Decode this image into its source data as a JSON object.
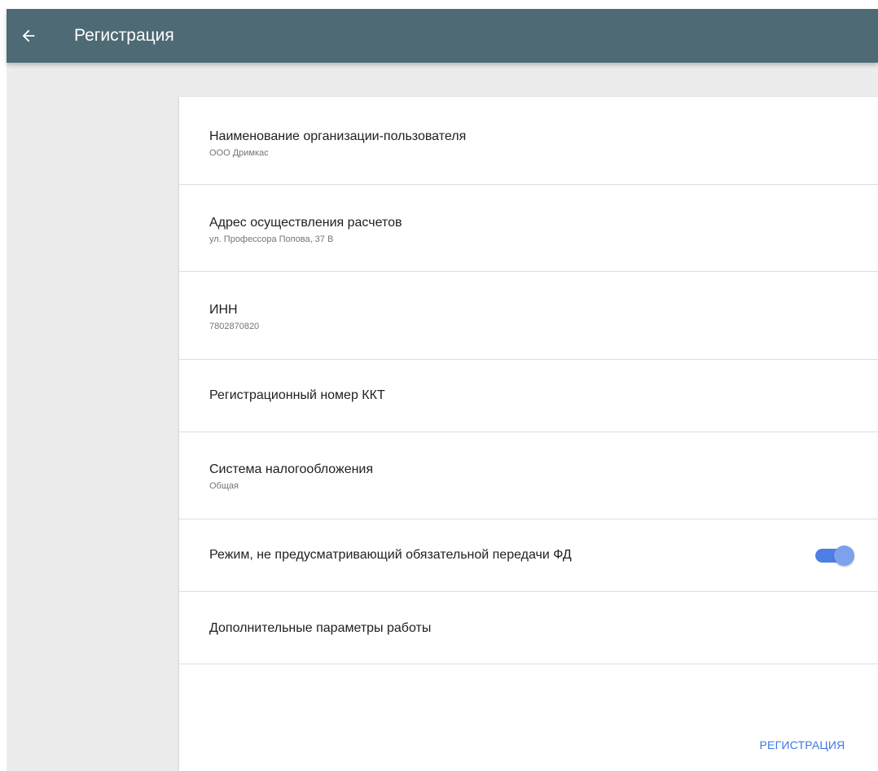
{
  "appbar": {
    "title": "Регистрация",
    "back_icon": "arrow-left-icon"
  },
  "form": {
    "items": [
      {
        "title": "Наименование организации-пользователя",
        "subtitle": "ООО Дримкас"
      },
      {
        "title": "Адрес осуществления расчетов",
        "subtitle": "ул. Профессора Попова, 37 В"
      },
      {
        "title": "ИНН",
        "subtitle": "7802870820"
      },
      {
        "title": "Регистрационный номер ККТ"
      },
      {
        "title": "Система налогообложения",
        "subtitle": "Общая"
      },
      {
        "title": "Режим, не предусматривающий обязательной передачи ФД",
        "toggle_on": true
      },
      {
        "title": "Дополнительные параметры работы"
      }
    ],
    "submit_label": "РЕГИСТРАЦИЯ"
  },
  "colors": {
    "appbar": "#4e6a75",
    "accent": "#3b78e7",
    "background": "#ececec"
  }
}
